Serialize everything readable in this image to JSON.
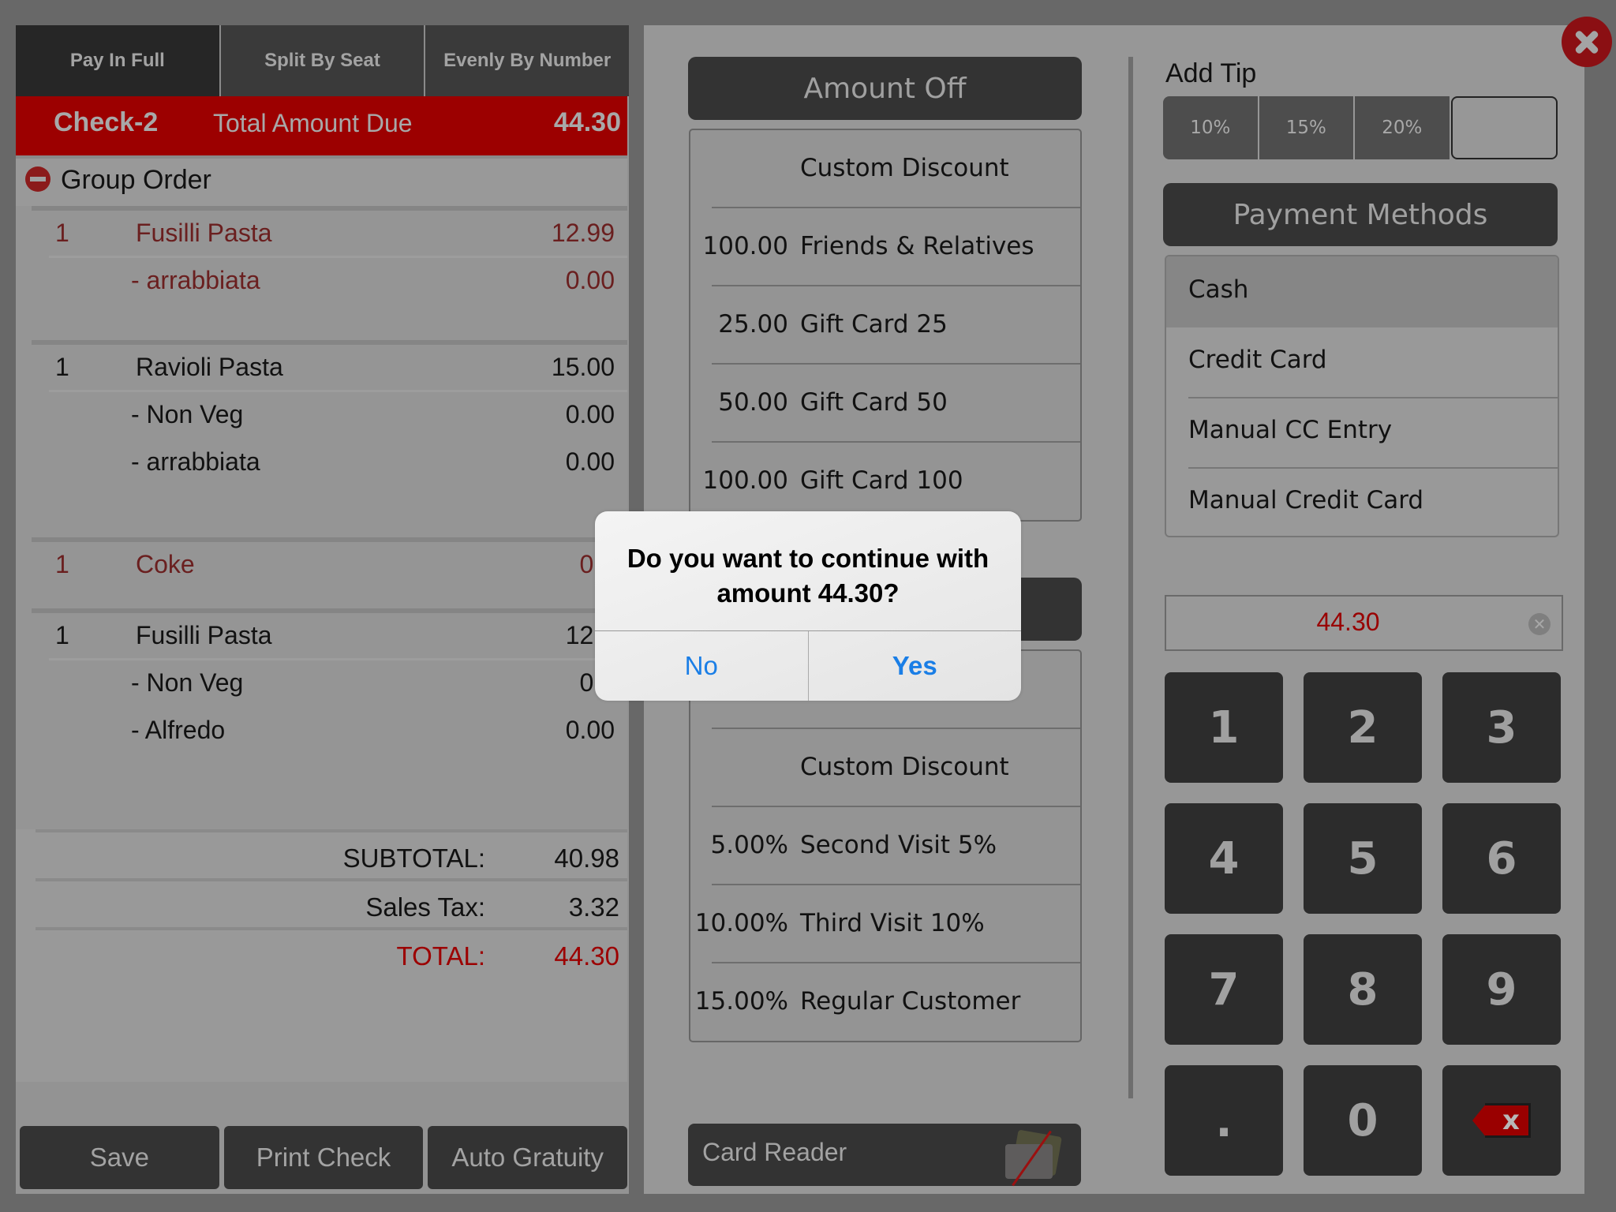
{
  "split_tabs": [
    "Pay In Full",
    "Split By Seat",
    "Evenly By Number"
  ],
  "check": {
    "name": "Check-2",
    "due_label": "Total Amount Due",
    "due_value": "44.30"
  },
  "group": {
    "title": "Group Order"
  },
  "order_items": [
    {
      "qty": "1",
      "name": "Fusilli Pasta",
      "price": "12.99",
      "color": "red",
      "modifiers": [
        {
          "name": "- arrabbiata",
          "price": "0.00"
        }
      ]
    },
    {
      "qty": "1",
      "name": "Ravioli Pasta",
      "price": "15.00",
      "color": "black",
      "modifiers": [
        {
          "name": "- Non Veg",
          "price": "0.00"
        },
        {
          "name": "- arrabbiata",
          "price": "0.00"
        }
      ]
    },
    {
      "qty": "1",
      "name": "Coke",
      "price": "0.0",
      "color": "red",
      "modifiers": []
    },
    {
      "qty": "1",
      "name": "Fusilli Pasta",
      "price": "12.9",
      "color": "black",
      "modifiers": [
        {
          "name": "- Non Veg",
          "price": "0.0"
        },
        {
          "name": "- Alfredo",
          "price": "0.00"
        }
      ]
    }
  ],
  "totals": {
    "subtotal_label": "SUBTOTAL:",
    "subtotal": "40.98",
    "tax_label": "Sales Tax:",
    "tax": "3.32",
    "total_label": "TOTAL:",
    "total": "44.30"
  },
  "bottom_buttons": [
    "Save",
    "Print Check",
    "Auto Gratuity"
  ],
  "amount_off": {
    "header": "Amount Off",
    "items": [
      {
        "amount": "",
        "name": "Custom Discount"
      },
      {
        "amount": "100.00",
        "name": "Friends & Relatives"
      },
      {
        "amount": "25.00",
        "name": "Gift Card 25"
      },
      {
        "amount": "50.00",
        "name": "Gift Card 50"
      },
      {
        "amount": "100.00",
        "name": "Gift Card 100"
      }
    ]
  },
  "percent_off": {
    "header": "",
    "items": [
      {
        "amount": "",
        "name": ""
      },
      {
        "amount": "",
        "name": "Custom Discount"
      },
      {
        "amount": "5.00%",
        "name": "Second Visit 5%"
      },
      {
        "amount": "10.00%",
        "name": "Third Visit 10%"
      },
      {
        "amount": "15.00%",
        "name": "Regular Customer"
      }
    ]
  },
  "card_reader": {
    "label": "Card Reader",
    "icon": "card-reader-disconnected-icon"
  },
  "tip": {
    "label": "Add Tip",
    "options": [
      "10%",
      "15%",
      "20%"
    ],
    "custom_value": ""
  },
  "payment_methods": {
    "header": "Payment Methods",
    "items": [
      "Cash",
      "Credit Card",
      "Manual CC Entry",
      "Manual Credit Card"
    ],
    "selected": "Cash"
  },
  "amount_input": {
    "value": "44.30"
  },
  "keypad": [
    "1",
    "2",
    "3",
    "4",
    "5",
    "6",
    "7",
    "8",
    "9",
    ".",
    "0",
    "⌫"
  ],
  "dialog": {
    "message": "Do you want to continue with amount 44.30?",
    "no_label": "No",
    "yes_label": "Yes"
  },
  "colors": {
    "accent_red": "#9c0000",
    "dialog_button_blue": "#1a7ee6",
    "dark_button": "#333333"
  }
}
